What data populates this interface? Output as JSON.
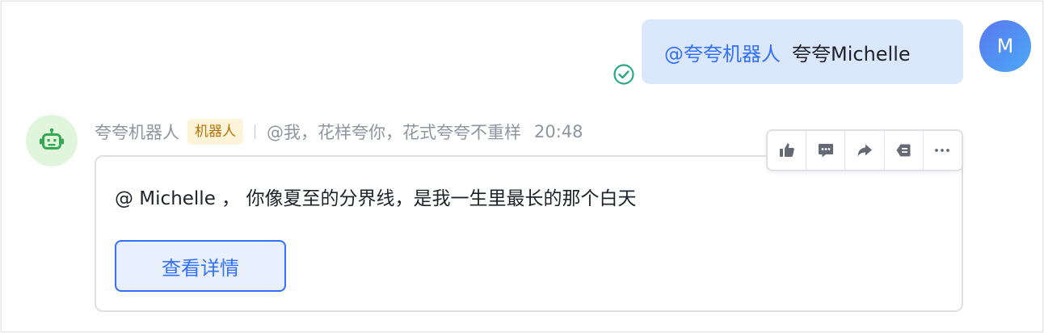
{
  "outgoing": {
    "mention": "@夸夸机器人",
    "text": "夸夸Michelle",
    "status_icon": "read-check-icon",
    "avatar_letter": "M"
  },
  "bot": {
    "name": "夸夸机器人",
    "badge": "机器人",
    "description": "@我，花样夸你，花式夸夸不重样",
    "time": "20:48",
    "avatar_icon": "robot-icon",
    "card": {
      "text": "@ Michelle ，  你像夏至的分界线，是我一生里最长的那个白天",
      "button_label": "查看详情"
    }
  },
  "toolbar": {
    "icons": [
      "thumbs-up-icon",
      "reply-icon",
      "forward-icon",
      "pin-icon",
      "more-icon"
    ]
  },
  "colors": {
    "accent": "#3370ff",
    "bubble_bg": "#dbe7fd",
    "badge_bg": "#fdf3d9",
    "badge_text": "#b2740b",
    "bot_avatar_bg": "#e1f5dc",
    "bot_icon": "#34a853",
    "read_check": "#2ea88a"
  }
}
